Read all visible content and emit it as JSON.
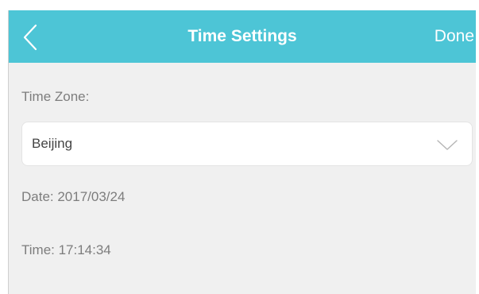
{
  "header": {
    "title": "Time Settings",
    "done_label": "Done",
    "back_icon": "chevron-left-icon"
  },
  "time_zone": {
    "label": "Time Zone:",
    "selected": "Beijing",
    "dropdown_icon": "chevron-down-icon"
  },
  "date_text": "Date: 2017/03/24",
  "time_text": "Time: 17:14:34",
  "colors": {
    "header_bg": "#4dc5d6",
    "background": "#f0f0f0",
    "text_muted": "#7d7d7d"
  }
}
